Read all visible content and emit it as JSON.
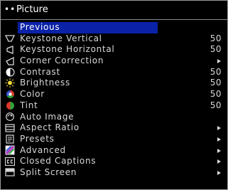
{
  "window": {
    "title": "Picture",
    "dots": "••"
  },
  "menu": {
    "items": [
      {
        "label": "Previous"
      },
      {
        "label": "Keystone Vertical",
        "value": "50"
      },
      {
        "label": "Keystone Horizontal",
        "value": "50"
      },
      {
        "label": "Corner Correction"
      },
      {
        "label": "Contrast",
        "value": "50"
      },
      {
        "label": "Brightness",
        "value": "50"
      },
      {
        "label": "Color",
        "value": "50"
      },
      {
        "label": "Tint",
        "value": "50"
      },
      {
        "label": "Auto Image"
      },
      {
        "label": "Aspect Ratio"
      },
      {
        "label": "Presets"
      },
      {
        "label": "Advanced"
      },
      {
        "label": "Closed Captions"
      },
      {
        "label": "Split Screen"
      }
    ]
  },
  "colors": {
    "background": "#000000",
    "highlight": "#0a22a8",
    "text": "#d8d8d8"
  }
}
